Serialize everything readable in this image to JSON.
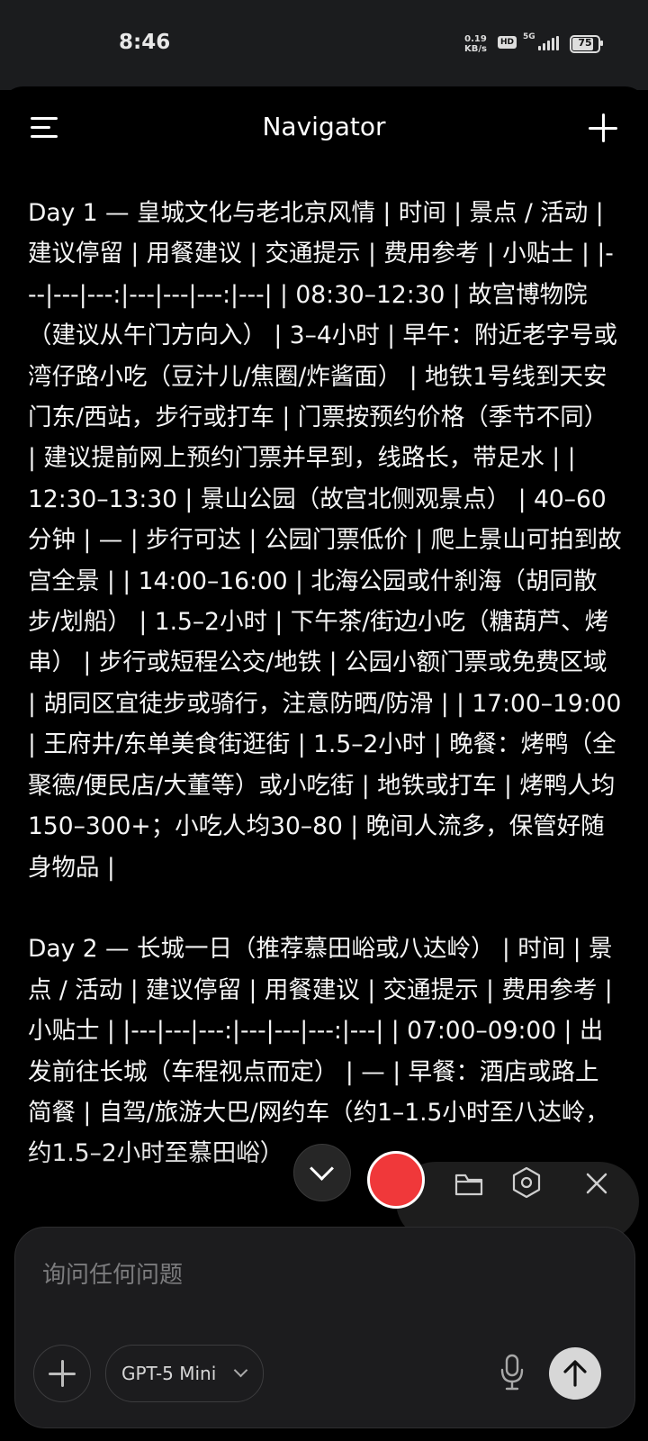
{
  "status_bar": {
    "time": "8:46",
    "net_speed_value": "0.19",
    "net_speed_unit": "KB/s",
    "hd": "HD",
    "network": "5G",
    "battery": "75"
  },
  "header": {
    "title": "Navigator"
  },
  "message": {
    "paragraphs": [
      "Day 1 — 皇城文化与老北京风情 | 时间 | 景点 / 活动 | 建议停留 | 用餐建议 | 交通提示 | 费用参考 | 小贴士 | |---|---|---:|---|---|---:|---| | 08:30–12:30 | 故宫博物院（建议从午门方向入） | 3–4小时 | 早午：附近老字号或湾仔路小吃（豆汁儿/焦圈/炸酱面） | 地铁1号线到天安门东/西站，步行或打车 | 门票按预约价格（季节不同） | 建议提前网上预约门票并早到，线路长，带足水 | | 12:30–13:30 | 景山公园（故宫北侧观景点） | 40–60分钟 | — | 步行可达 | 公园门票低价 | 爬上景山可拍到故宫全景 | | 14:00–16:00 | 北海公园或什刹海（胡同散步/划船） | 1.5–2小时 | 下午茶/街边小吃（糖葫芦、烤串） | 步行或短程公交/地铁 | 公园小额门票或免费区域 | 胡同区宜徒步或骑行，注意防晒/防滑 | | 17:00–19:00 | 王府井/东单美食街逛街 | 1.5–2小时 | 晚餐：烤鸭（全聚德/便民店/大董等）或小吃街 | 地铁或打车 | 烤鸭人均150–300+；小吃人均30–80 | 晚间人流多，保管好随身物品 |",
      "Day 2 — 长城一日（推荐慕田峪或八达岭） | 时间 | 景点 / 活动 | 建议停留 | 用餐建议 | 交通提示 | 费用参考 | 小贴士 | |---|---|---:|---|---|---:|---| | 07:00–09:00 | 出发前往长城（车程视点而定） | — | 早餐：酒店或路上简餐 | 自驾/旅游大巴/网约车（约1–1.5小时至八达岭，约1.5–2小时至慕田峪）"
    ]
  },
  "composer": {
    "placeholder": "询问任何问题",
    "model": "GPT-5 Mini"
  },
  "icons": [
    "menu-icon",
    "new-chat-icon",
    "chevron-down-icon",
    "record-icon",
    "folder-icon",
    "camera-icon",
    "close-icon",
    "plus-icon",
    "microphone-icon",
    "arrow-up-icon"
  ],
  "colors": {
    "background": "#000000",
    "record": "#f0383a",
    "composer": "#1c1c1e",
    "send_button": "#d7d7d7"
  }
}
